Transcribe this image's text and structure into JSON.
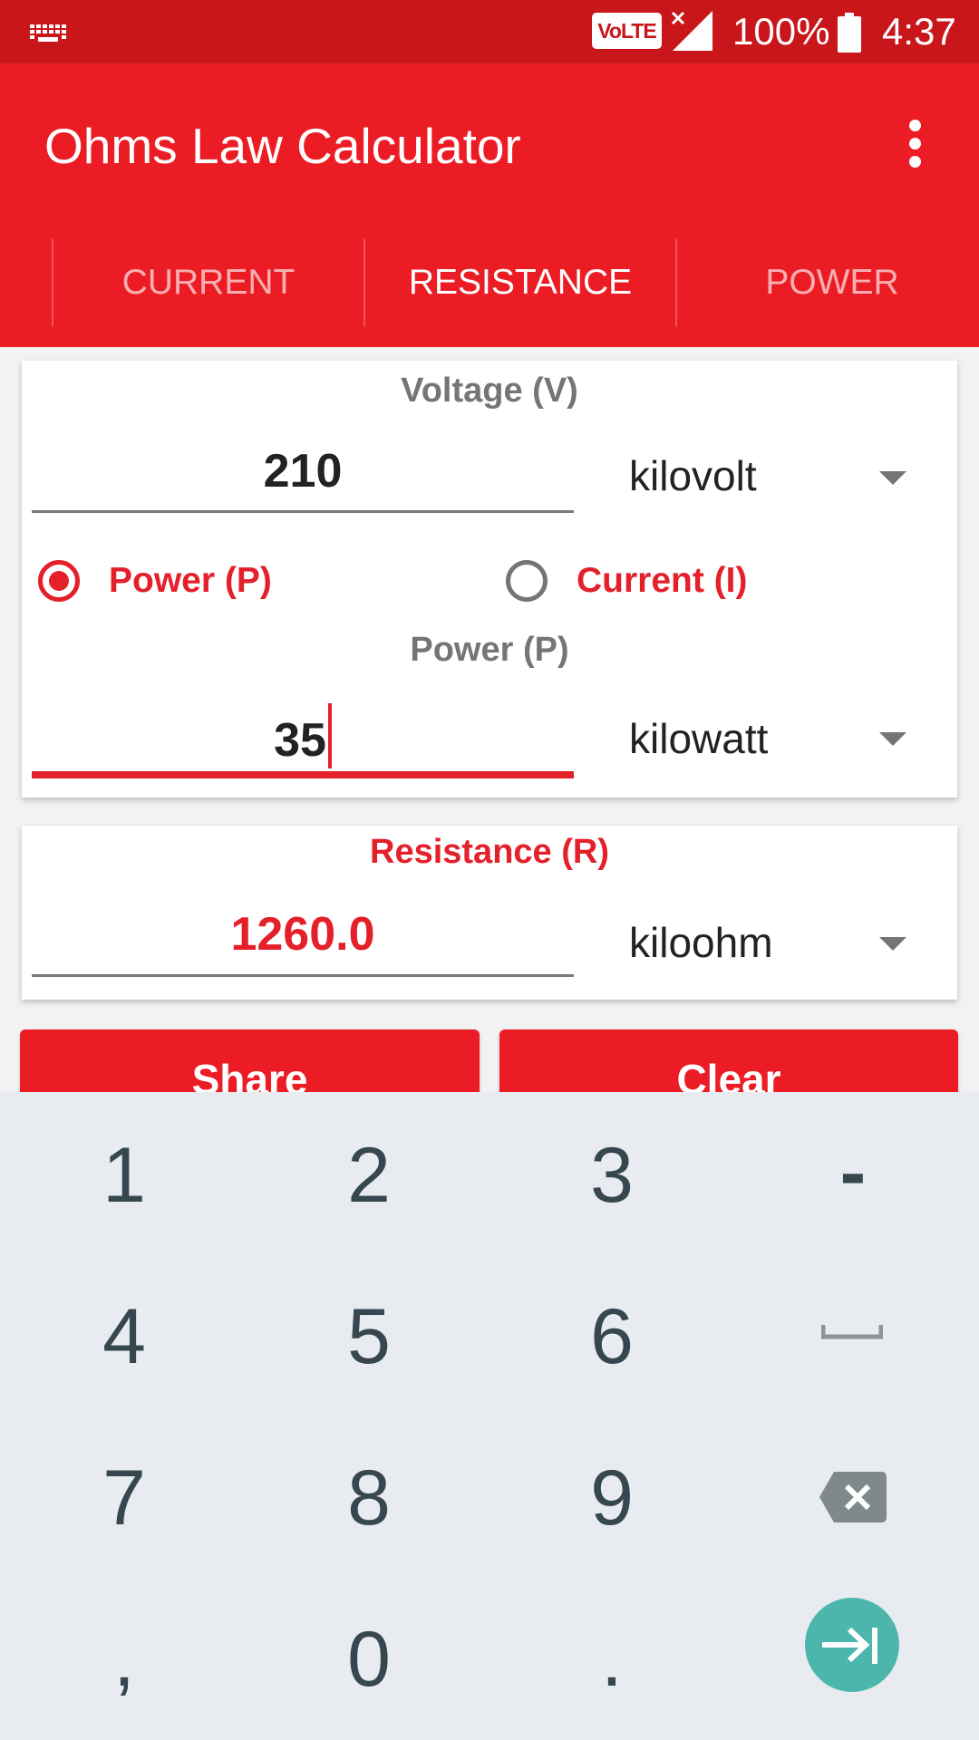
{
  "status_bar": {
    "left_icon": "keyboard-icon",
    "volte_label": "VoLTE",
    "signal_icon": "signal-no-service-icon",
    "battery_percent": "100%",
    "battery_icon": "battery-full-icon",
    "time": "4:37"
  },
  "app_bar": {
    "title": "Ohms Law Calculator",
    "menu_icon": "overflow-menu-icon"
  },
  "tabs": [
    {
      "label": "CURRENT",
      "active": false
    },
    {
      "label": "RESISTANCE",
      "active": true
    },
    {
      "label": "POWER",
      "active": false
    }
  ],
  "inputs_card": {
    "voltage": {
      "label": "Voltage (V)",
      "value": "210",
      "unit": "kilovolt"
    },
    "mode_options": [
      {
        "label": "Power (P)",
        "selected": true
      },
      {
        "label": "Current (I)",
        "selected": false
      }
    ],
    "power": {
      "label": "Power (P)",
      "value": "35",
      "unit": "kilowatt"
    }
  },
  "result_card": {
    "label": "Resistance (R)",
    "value": "1260.0",
    "unit": "kiloohm"
  },
  "actions": {
    "share_label": "Share",
    "clear_label": "Clear"
  },
  "keyboard": {
    "rows": [
      [
        "1",
        "2",
        "3",
        "-"
      ],
      [
        "4",
        "5",
        "6",
        "space"
      ],
      [
        "7",
        "8",
        "9",
        "backspace"
      ],
      [
        ",",
        "0",
        ".",
        "tab"
      ]
    ]
  },
  "colors": {
    "status_bar": "#C8161B",
    "primary": "#EC1C24",
    "accent": "#E4202A",
    "keyboard_bg": "#E8ECF0",
    "tab_key": "#4DB6AC"
  }
}
